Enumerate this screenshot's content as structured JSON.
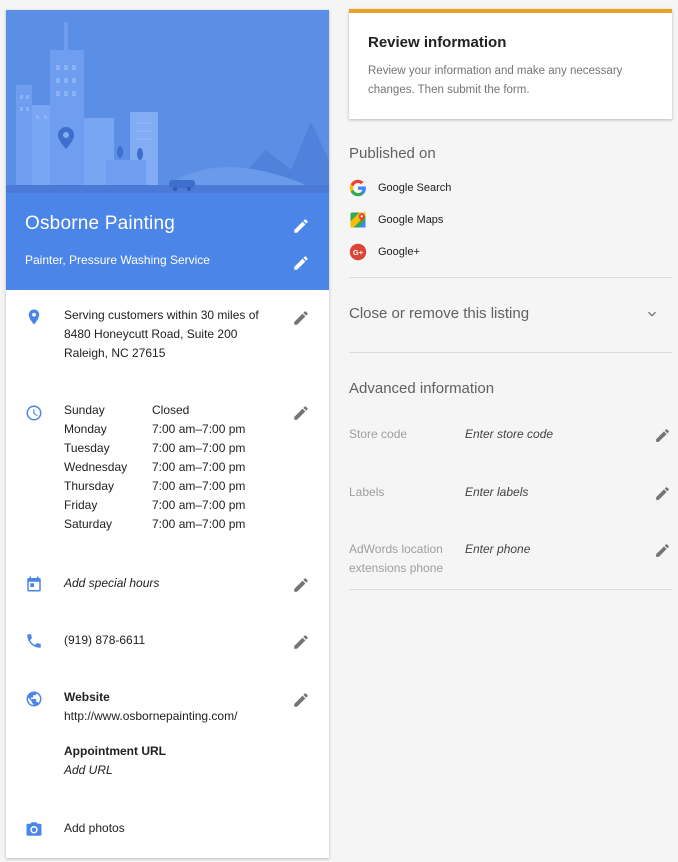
{
  "business": {
    "name": "Osborne Painting",
    "categories": "Painter, Pressure Washing Service"
  },
  "address": {
    "line1": "Serving customers within 30 miles of",
    "line2": "8480 Honeycutt Road, Suite 200",
    "line3": "Raleigh, NC 27615"
  },
  "hours": [
    {
      "day": "Sunday",
      "time": "Closed"
    },
    {
      "day": "Monday",
      "time": "7:00 am–7:00 pm"
    },
    {
      "day": "Tuesday",
      "time": "7:00 am–7:00 pm"
    },
    {
      "day": "Wednesday",
      "time": "7:00 am–7:00 pm"
    },
    {
      "day": "Thursday",
      "time": "7:00 am–7:00 pm"
    },
    {
      "day": "Friday",
      "time": "7:00 am–7:00 pm"
    },
    {
      "day": "Saturday",
      "time": "7:00 am–7:00 pm"
    }
  ],
  "special_hours": "Add special hours",
  "phone": "(919) 878-6611",
  "website": {
    "label": "Website",
    "url": "http://www.osbornepainting.com/",
    "appointment_label": "Appointment URL",
    "appointment_value": "Add URL"
  },
  "photos_label": "Add photos",
  "review": {
    "title": "Review information",
    "description": "Review your information and make any necessary changes. Then submit the form."
  },
  "published": {
    "title": "Published on",
    "items": [
      "Google Search",
      "Google Maps",
      "Google+"
    ]
  },
  "close_listing": "Close or remove this listing",
  "advanced": {
    "title": "Advanced information",
    "fields": [
      {
        "label": "Store code",
        "value": "Enter store code"
      },
      {
        "label": "Labels",
        "value": "Enter labels"
      },
      {
        "label": "AdWords location extensions phone",
        "value": "Enter phone"
      }
    ]
  },
  "colors": {
    "accent_blue": "#4c85e8",
    "hero_blue": "#5b8fe6",
    "review_bar": "#e8a120",
    "icon_blue": "#4c85e8"
  }
}
